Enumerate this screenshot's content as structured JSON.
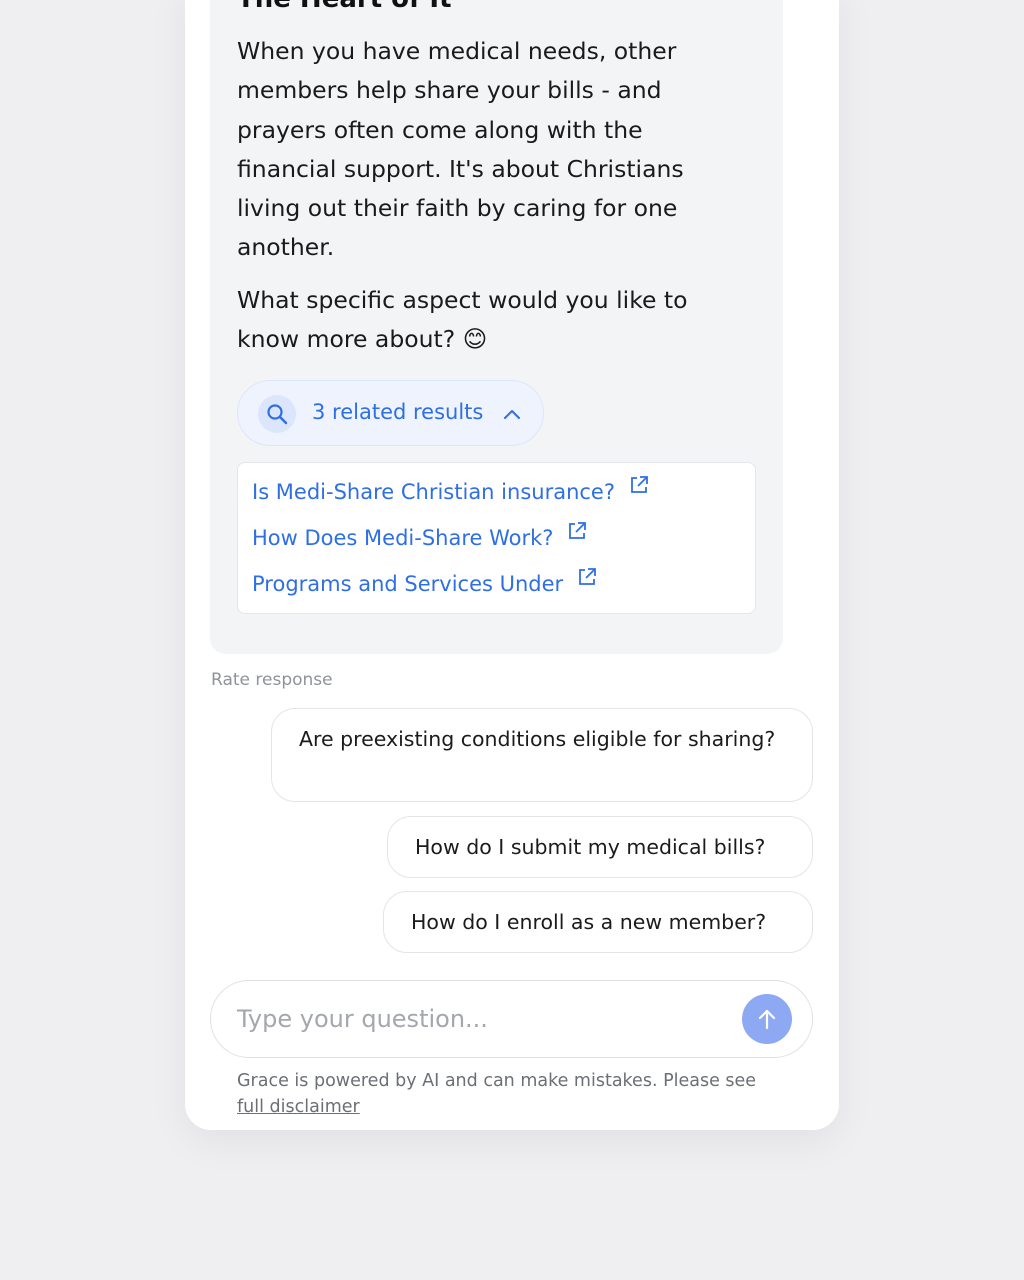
{
  "colors": {
    "accent": "#2f6fe4",
    "send_button": "#8ea9f4",
    "bubble_bg": "#f3f4f6",
    "page_bg": "#efeff1"
  },
  "message": {
    "heading": "The Heart of It",
    "paragraph_1": "When you have medical needs, other members help share your bills - and prayers often come along with the financial support. It's about Christians living out their faith by caring for one another.",
    "paragraph_2_text": "What specific aspect would you like to know more about?",
    "paragraph_2_emoji": "😊"
  },
  "related": {
    "label": "3 related results",
    "search_icon": "search-icon",
    "toggle_icon": "chevron-up-icon",
    "links": [
      {
        "label": "Is Medi-Share Christian insurance?",
        "icon": "external-link-icon"
      },
      {
        "label": "How Does Medi-Share Work?",
        "icon": "external-link-icon"
      },
      {
        "label": "Programs and Services Under",
        "icon": "external-link-icon"
      }
    ]
  },
  "rate_label": "Rate response",
  "suggestions": [
    "Are preexisting conditions eligible for sharing?",
    "How do I submit my medical bills?",
    "How do I enroll as a new member?"
  ],
  "composer": {
    "placeholder": "Type your question...",
    "send_icon": "arrow-up-icon"
  },
  "disclaimer": {
    "text": "Grace is powered by AI and can make mistakes. Please see",
    "link_label": "full disclaimer"
  }
}
